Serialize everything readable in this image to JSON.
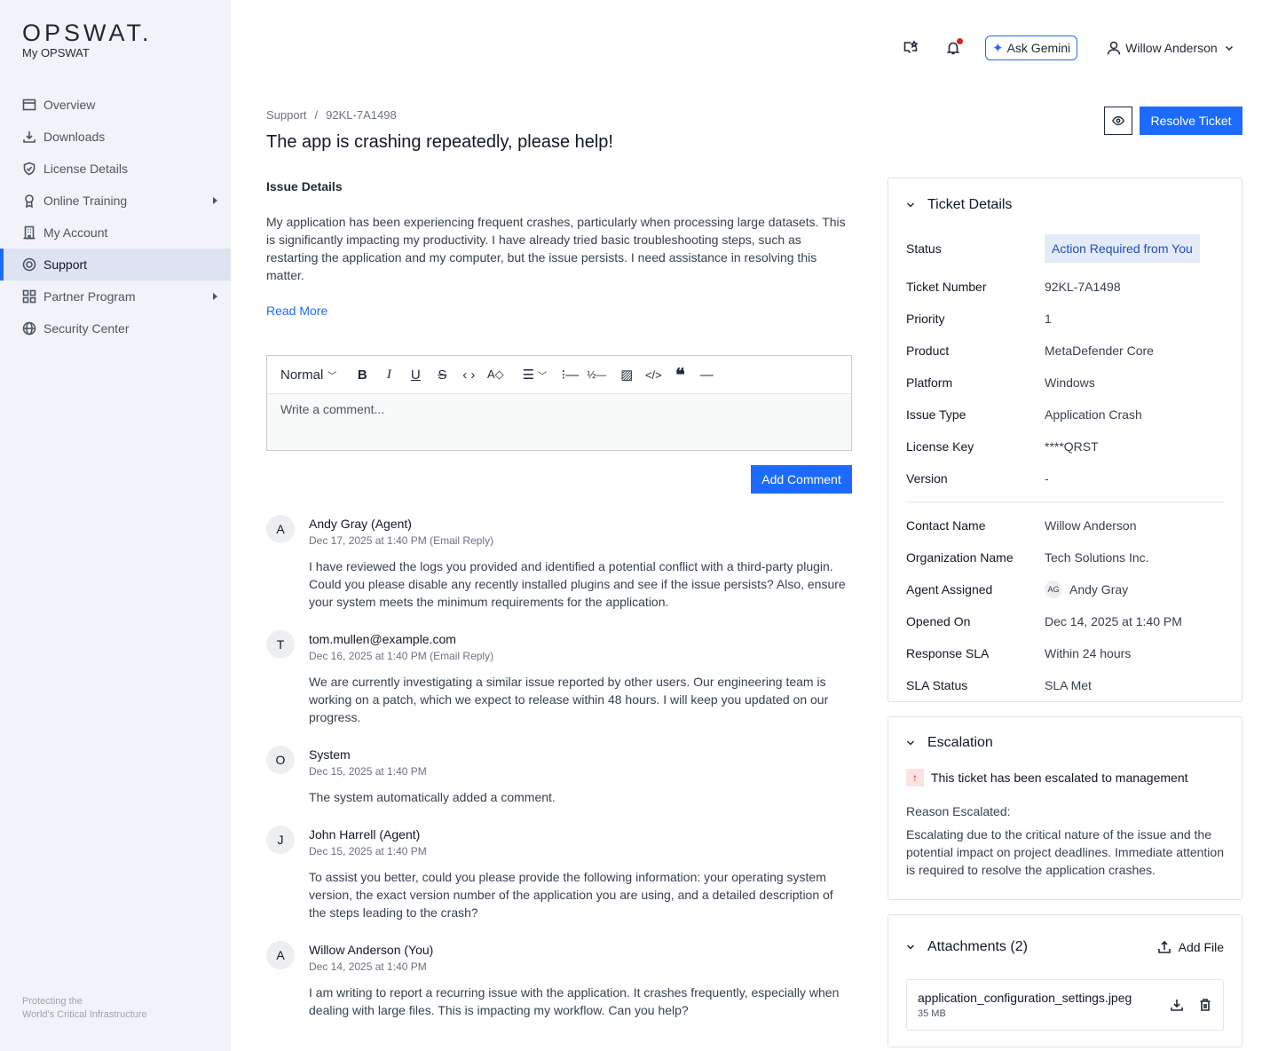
{
  "brand": {
    "logo": "OPSWAT.",
    "subtitle": "My OPSWAT",
    "footer_line1": "Protecting the",
    "footer_line2": "World's Critical Infrastructure"
  },
  "sidebar": {
    "items": [
      {
        "label": "Overview",
        "icon": "overview-icon"
      },
      {
        "label": "Downloads",
        "icon": "download-icon"
      },
      {
        "label": "License Details",
        "icon": "shield-check-icon"
      },
      {
        "label": "Online Training",
        "icon": "award-icon",
        "submenu": true
      },
      {
        "label": "My Account",
        "icon": "building-icon"
      },
      {
        "label": "Support",
        "icon": "lifebuoy-icon",
        "active": true
      },
      {
        "label": "Partner Program",
        "icon": "grid-icon",
        "submenu": true
      },
      {
        "label": "Security Center",
        "icon": "globe-icon"
      }
    ]
  },
  "header": {
    "ask_gemini": "Ask Gemini",
    "user_name": "Willow Anderson"
  },
  "breadcrumb": {
    "root": "Support",
    "sep": "/",
    "current": "92KL-7A1498"
  },
  "ticket": {
    "title": "The app is crashing repeatedly, please help!",
    "resolve_label": "Resolve Ticket"
  },
  "issue": {
    "heading": "Issue Details",
    "text": "My application has been experiencing frequent crashes, particularly when processing large datasets. This is significantly impacting my productivity. I have already tried basic troubleshooting steps, such as restarting the application and my computer, but the issue persists. I need assistance in resolving this matter.",
    "read_more": "Read More"
  },
  "editor": {
    "format": "Normal",
    "placeholder": "Write a comment...",
    "submit": "Add Comment"
  },
  "comments": [
    {
      "initial": "A",
      "author": "Andy Gray (Agent)",
      "date": "Dec 17, 2025 at 1:40 PM (Email Reply)",
      "text": "I have reviewed the logs you provided and identified a potential conflict with a third-party plugin. Could you please disable any recently installed plugins and see if the issue persists? Also, ensure your system meets the minimum requirements for the application."
    },
    {
      "initial": "T",
      "author": "tom.mullen@example.com",
      "date": "Dec 16, 2025 at 1:40 PM (Email Reply)",
      "text": "We are currently investigating a similar issue reported by other users. Our engineering team is working on a patch, which we expect to release within 48 hours. I will keep you updated on our progress."
    },
    {
      "initial": "O",
      "author": "System",
      "date": "Dec 15, 2025 at 1:40 PM",
      "text": "The system automatically added a comment."
    },
    {
      "initial": "J",
      "author": "John Harrell (Agent)",
      "date": "Dec 15, 2025 at 1:40 PM",
      "text": "To assist you better, could you please provide the following information: your operating system version, the exact version number of the application you are using, and a detailed description of the steps leading to the crash?"
    },
    {
      "initial": "A",
      "author": "Willow Anderson (You)",
      "date": "Dec 14, 2025 at 1:40 PM",
      "text": "I am writing to report a recurring issue with the application. It crashes frequently, especially when dealing with large files. This is impacting my workflow. Can you help?"
    }
  ],
  "details": {
    "heading": "Ticket Details",
    "rows1": [
      {
        "label": "Status",
        "value": "Action Required from You"
      },
      {
        "label": "Ticket Number",
        "value": "92KL-7A1498"
      },
      {
        "label": "Priority",
        "value": "1"
      },
      {
        "label": "Product",
        "value": "MetaDefender Core"
      },
      {
        "label": "Platform",
        "value": "Windows"
      },
      {
        "label": "Issue Type",
        "value": "Application Crash"
      },
      {
        "label": "License Key",
        "value": "****QRST"
      },
      {
        "label": "Version",
        "value": "-"
      }
    ],
    "rows2": [
      {
        "label": "Contact Name",
        "value": "Willow Anderson"
      },
      {
        "label": "Organization Name",
        "value": "Tech Solutions Inc."
      },
      {
        "label": "Agent Assigned",
        "value": "Andy Gray",
        "initials": "AG"
      },
      {
        "label": "Opened On",
        "value": "Dec 14, 2025 at 1:40 PM"
      },
      {
        "label": "Response SLA",
        "value": "Within 24 hours"
      },
      {
        "label": "SLA Status",
        "value": "SLA Met"
      }
    ]
  },
  "escalation": {
    "heading": "Escalation",
    "notice": "This ticket has been escalated to management",
    "reason_label": "Reason Escalated:",
    "reason": "Escalating due to the critical nature of the issue and the potential impact on project deadlines. Immediate attention is required to resolve the application crashes."
  },
  "attachments": {
    "heading": "Attachments (2)",
    "add_file": "Add File",
    "files": [
      {
        "name": "application_configuration_settings.jpeg",
        "size": "35 MB"
      }
    ]
  }
}
